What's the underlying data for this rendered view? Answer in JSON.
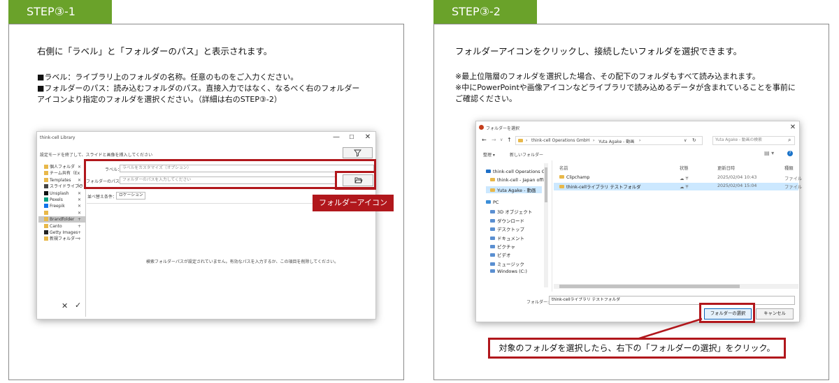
{
  "left": {
    "step_label": "STEP③-1",
    "lead": "右側に「ラベル」と「フォルダーのパス」と表示されます。",
    "note1": "■ラベル：ライブラリ上のフォルダの名称。任意のものをご入力ください。",
    "note2a": "■フォルダーのパス：読み込むフォルダのパス。直接入力ではなく、なるべく右のフォルダー",
    "note2b": "アイコンより指定のフォルダを選択ください。（詳細は右のSTEP③-2）",
    "window": {
      "title": "think-cell Library",
      "controls": [
        "—",
        "☐",
        "✕"
      ],
      "instruction": "設定モードを終了して、スライドと画像を挿入してください",
      "filter_icon": "filter-icon",
      "label_caption": "ラベル：",
      "label_placeholder": "ラベルをカスタマイズ（オプション）",
      "path_caption": "フォルダーのパス：",
      "path_placeholder": "フォルダーのパスを入力してください",
      "sort_caption": "並べ替え条件：",
      "sort_value": "ロケーション",
      "empty_message": "検索フォルダーパスが設定されていません。有効なパスを入力するか、この項目を削除してください。",
      "sidebar": [
        {
          "label": "個人フォルダ",
          "mark": "✕",
          "color": "#e8b84a"
        },
        {
          "label": "チーム共有（Ex",
          "mark": "",
          "color": "#e8b84a"
        },
        {
          "label": "Templates",
          "mark": "✕",
          "color": "#e8b84a"
        },
        {
          "label": "スライドライブラ",
          "mark": "✕",
          "color": "#444444"
        },
        {
          "label": "Unsplash",
          "mark": "✕",
          "color": "#111111"
        },
        {
          "label": "Pexels",
          "mark": "✕",
          "color": "#05a081"
        },
        {
          "label": "Freepik",
          "mark": "✕",
          "color": "#1273eb"
        },
        {
          "label": "",
          "mark": "✕",
          "color": "#e8b84a"
        },
        {
          "label": "Brandfolder",
          "mark": "+",
          "color": "#e8b84a"
        },
        {
          "label": "Canto",
          "mark": "+",
          "color": "#e8b84a"
        },
        {
          "label": "Getty Images",
          "mark": "+",
          "color": "#222222"
        },
        {
          "label": "新規フォルダー",
          "mark": "+",
          "color": "#e8b84a"
        }
      ],
      "footer_cancel": "✕",
      "footer_ok": "✓"
    },
    "callout": "フォルダーアイコン"
  },
  "right": {
    "step_label": "STEP③-2",
    "lead": "フォルダーアイコンをクリックし、接続したいフォルダを選択できます。",
    "note1": "※最上位階層のフォルダを選択した場合、その配下のフォルダもすべて読み込まれます。",
    "note2a": "※中にPowerPointや画像アイコンなどライブラリで読み込めるデータが含まれていることを事前に",
    "note2b": "ご確認ください。",
    "dialog": {
      "title": "フォルダーを選択",
      "close": "✕",
      "nav": [
        "←",
        "→",
        "∨",
        "↑"
      ],
      "breadcrumb": [
        "think-cell Operations GmbH",
        "Yuta Agake - 動画"
      ],
      "refresh": "↻",
      "search_placeholder": "Yuta Agake - 動画の検索",
      "organize": "整理 ▾",
      "new_folder": "新しいフォルダー",
      "tree_top": [
        {
          "label": "think-cell Operations G",
          "indent": 0
        },
        {
          "label": "think-cell - Japan offi",
          "indent": 1
        },
        {
          "label": "Yuta Agake - 動画",
          "indent": 1
        }
      ],
      "tree_pc": [
        {
          "label": "PC",
          "indent": 0
        },
        {
          "label": "3D オブジェクト",
          "indent": 1
        },
        {
          "label": "ダウンロード",
          "indent": 1
        },
        {
          "label": "デスクトップ",
          "indent": 1
        },
        {
          "label": "ドキュメント",
          "indent": 1
        },
        {
          "label": "ピクチャ",
          "indent": 1
        },
        {
          "label": "ビデオ",
          "indent": 1
        },
        {
          "label": "ミュージック",
          "indent": 1
        },
        {
          "label": "Windows (C:)",
          "indent": 1
        }
      ],
      "columns": [
        "名前",
        "状態",
        "更新日時",
        "種類"
      ],
      "rows": [
        {
          "name": "Clipchamp",
          "status": "☁ 𐀀",
          "date": "2025/02/04 10:43",
          "type": "ファイル"
        },
        {
          "name": "think-cellライブラリ テストフォルダ",
          "status": "☁ 𐀀",
          "date": "2025/02/04 15:04",
          "type": "ファイル"
        }
      ],
      "folder_caption": "フォルダー:",
      "folder_value": "think-cellライブラリ テストフォルダ",
      "select_button": "フォルダーの選択",
      "cancel_button": "キャンセル"
    },
    "callout": "対象のフォルダを選択したら、右下の「フォルダーの選択」をクリック。"
  },
  "colors": {
    "step_green": "#6aa22a",
    "callout_red": "#b1171c",
    "panel_border": "#8a8a8a",
    "selected_row": "#cce8ff"
  }
}
